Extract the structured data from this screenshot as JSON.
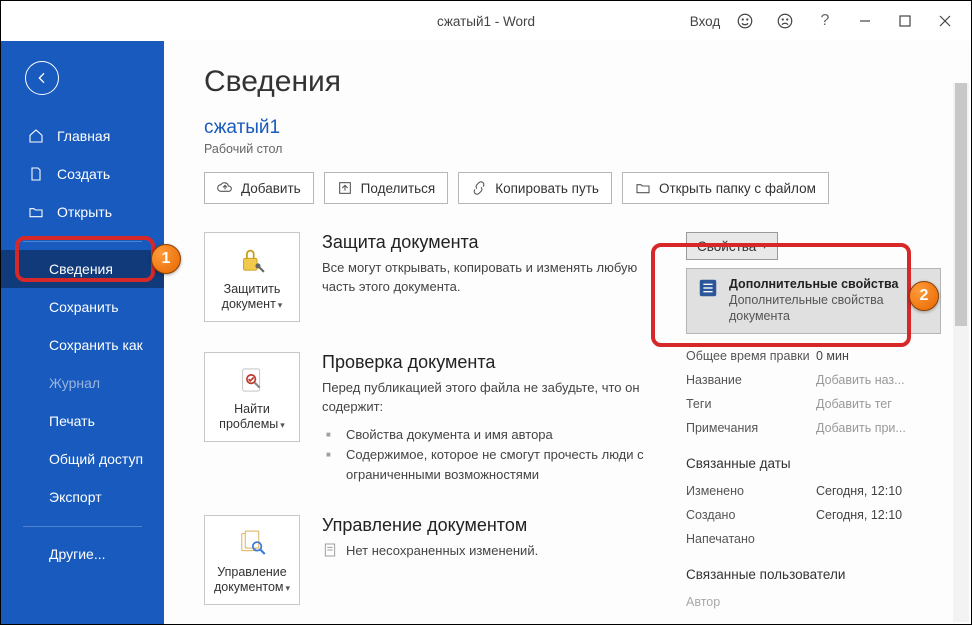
{
  "titlebar": {
    "title": "сжатый1  -  Word",
    "login": "Вход"
  },
  "sidebar": {
    "home": "Главная",
    "new": "Создать",
    "open": "Открыть",
    "info": "Сведения",
    "save": "Сохранить",
    "saveas": "Сохранить как",
    "history": "Журнал",
    "print": "Печать",
    "share": "Общий доступ",
    "export": "Экспорт",
    "more": "Другие..."
  },
  "page": {
    "heading": "Сведения",
    "doc_title": "сжатый1",
    "doc_location": "Рабочий стол"
  },
  "actions": {
    "upload": "Добавить",
    "share": "Поделиться",
    "copypath": "Копировать путь",
    "openfolder": "Открыть папку с файлом"
  },
  "sections": {
    "protect": {
      "btn": "Защитить документ",
      "title": "Защита документа",
      "desc": "Все могут открывать, копировать и изменять любую часть этого документа."
    },
    "inspect": {
      "btn": "Найти проблемы",
      "title": "Проверка документа",
      "desc": "Перед публикацией этого файла не забудьте, что он содержит:",
      "items": [
        "Свойства документа и имя автора",
        "Содержимое, которое не смогут прочесть люди с ограниченными возможностями"
      ]
    },
    "manage": {
      "btn": "Управление документом",
      "title": "Управление документом",
      "none": "Нет несохраненных изменений."
    }
  },
  "props": {
    "btn": "Свойства",
    "adv": {
      "title": "Дополнительные свойства",
      "sub": "Дополнительные свойства документа"
    },
    "rows": {
      "edit_time_k": "Общее время правки",
      "edit_time_v": "0 мин",
      "title_k": "Название",
      "title_v": "Добавить наз...",
      "tags_k": "Теги",
      "tags_v": "Добавить тег",
      "comments_k": "Примечания",
      "comments_v": "Добавить при..."
    },
    "dates_head": "Связанные даты",
    "dates": {
      "modified_k": "Изменено",
      "modified_v": "Сегодня, 12:10",
      "created_k": "Создано",
      "created_v": "Сегодня, 12:10",
      "printed_k": "Напечатано",
      "printed_v": ""
    },
    "people_head": "Связанные пользователи",
    "people": {
      "author_k": "Автор"
    }
  }
}
